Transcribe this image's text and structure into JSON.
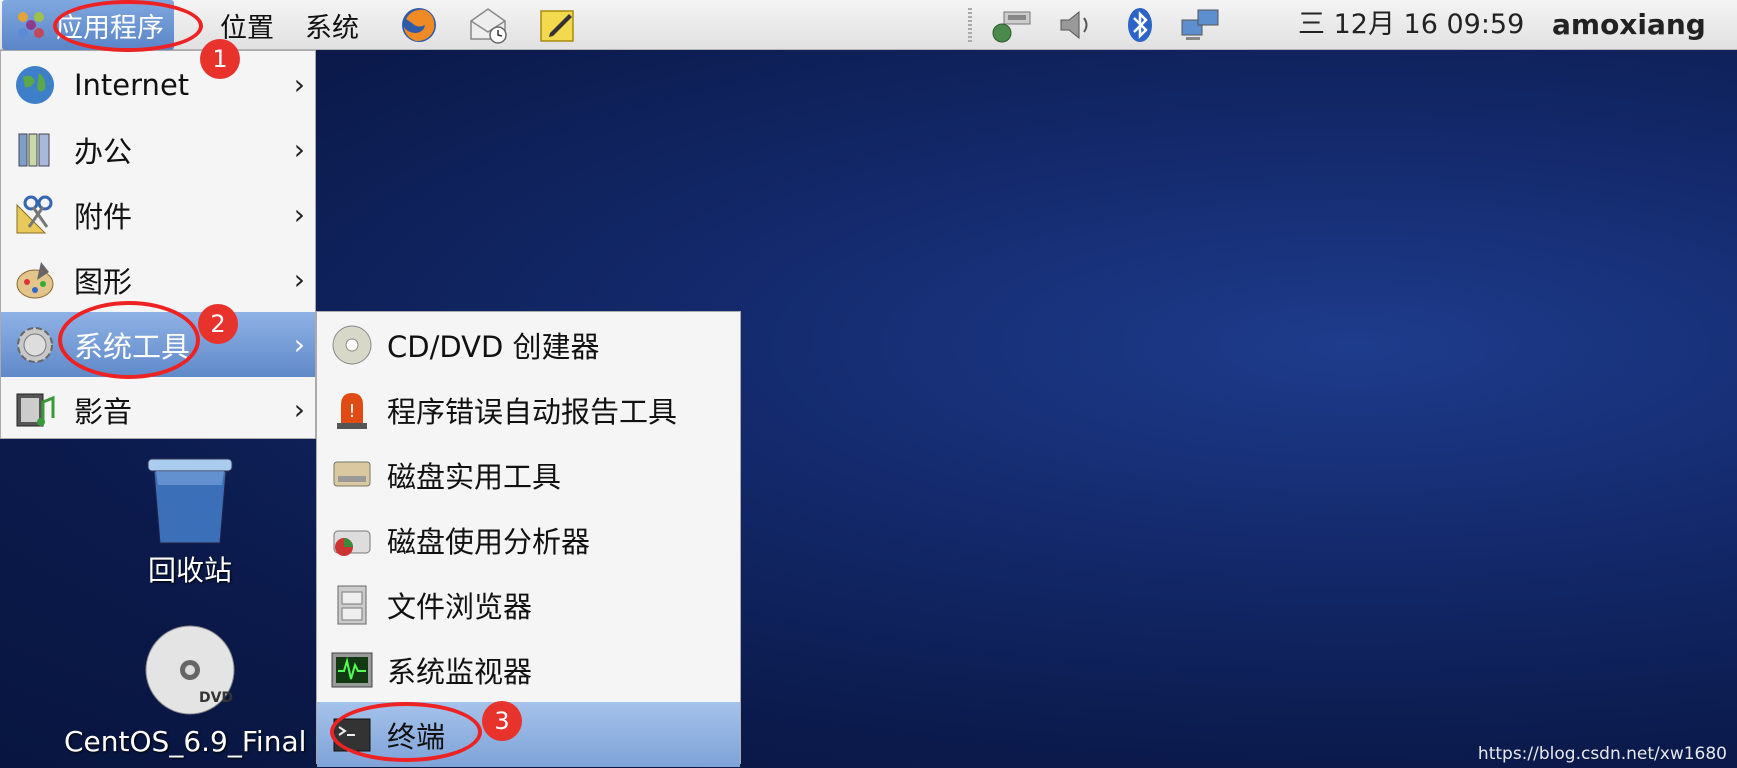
{
  "top_panel": {
    "applications_label": "应用程序",
    "places_label": "位置",
    "system_label": "系统",
    "launchers": [
      "firefox-icon",
      "mail-clock-icon",
      "notes-icon"
    ],
    "tray": [
      "network-icon",
      "volume-icon",
      "bluetooth-icon",
      "network-connections-icon"
    ],
    "clock": "三 12月 16 09:59",
    "user": "amoxiang"
  },
  "main_menu": {
    "items": [
      {
        "label": "Internet",
        "icon": "globe-icon"
      },
      {
        "label": "办公",
        "icon": "office-icon"
      },
      {
        "label": "附件",
        "icon": "accessories-icon"
      },
      {
        "label": "图形",
        "icon": "graphics-icon"
      },
      {
        "label": "系统工具",
        "icon": "gear-icon"
      },
      {
        "label": "影音",
        "icon": "multimedia-icon"
      }
    ],
    "arrow": "›"
  },
  "sub_menu": {
    "items": [
      {
        "label": "CD/DVD 创建器",
        "icon": "disc-burner-icon"
      },
      {
        "label": "程序错误自动报告工具",
        "icon": "alarm-icon"
      },
      {
        "label": "磁盘实用工具",
        "icon": "disk-utility-icon"
      },
      {
        "label": "磁盘使用分析器",
        "icon": "disk-usage-icon"
      },
      {
        "label": "文件浏览器",
        "icon": "file-cabinet-icon"
      },
      {
        "label": "系统监视器",
        "icon": "system-monitor-icon"
      },
      {
        "label": "终端",
        "icon": "terminal-icon"
      }
    ]
  },
  "desktop": {
    "trash_label": "回收站",
    "dvd_label": "CentOS_6.9_Final",
    "dvd_badge": "DVD"
  },
  "annotations": {
    "badges": [
      "1",
      "2",
      "3"
    ],
    "color": "#e8332d"
  },
  "watermark": "https://blog.csdn.net/xw1680"
}
